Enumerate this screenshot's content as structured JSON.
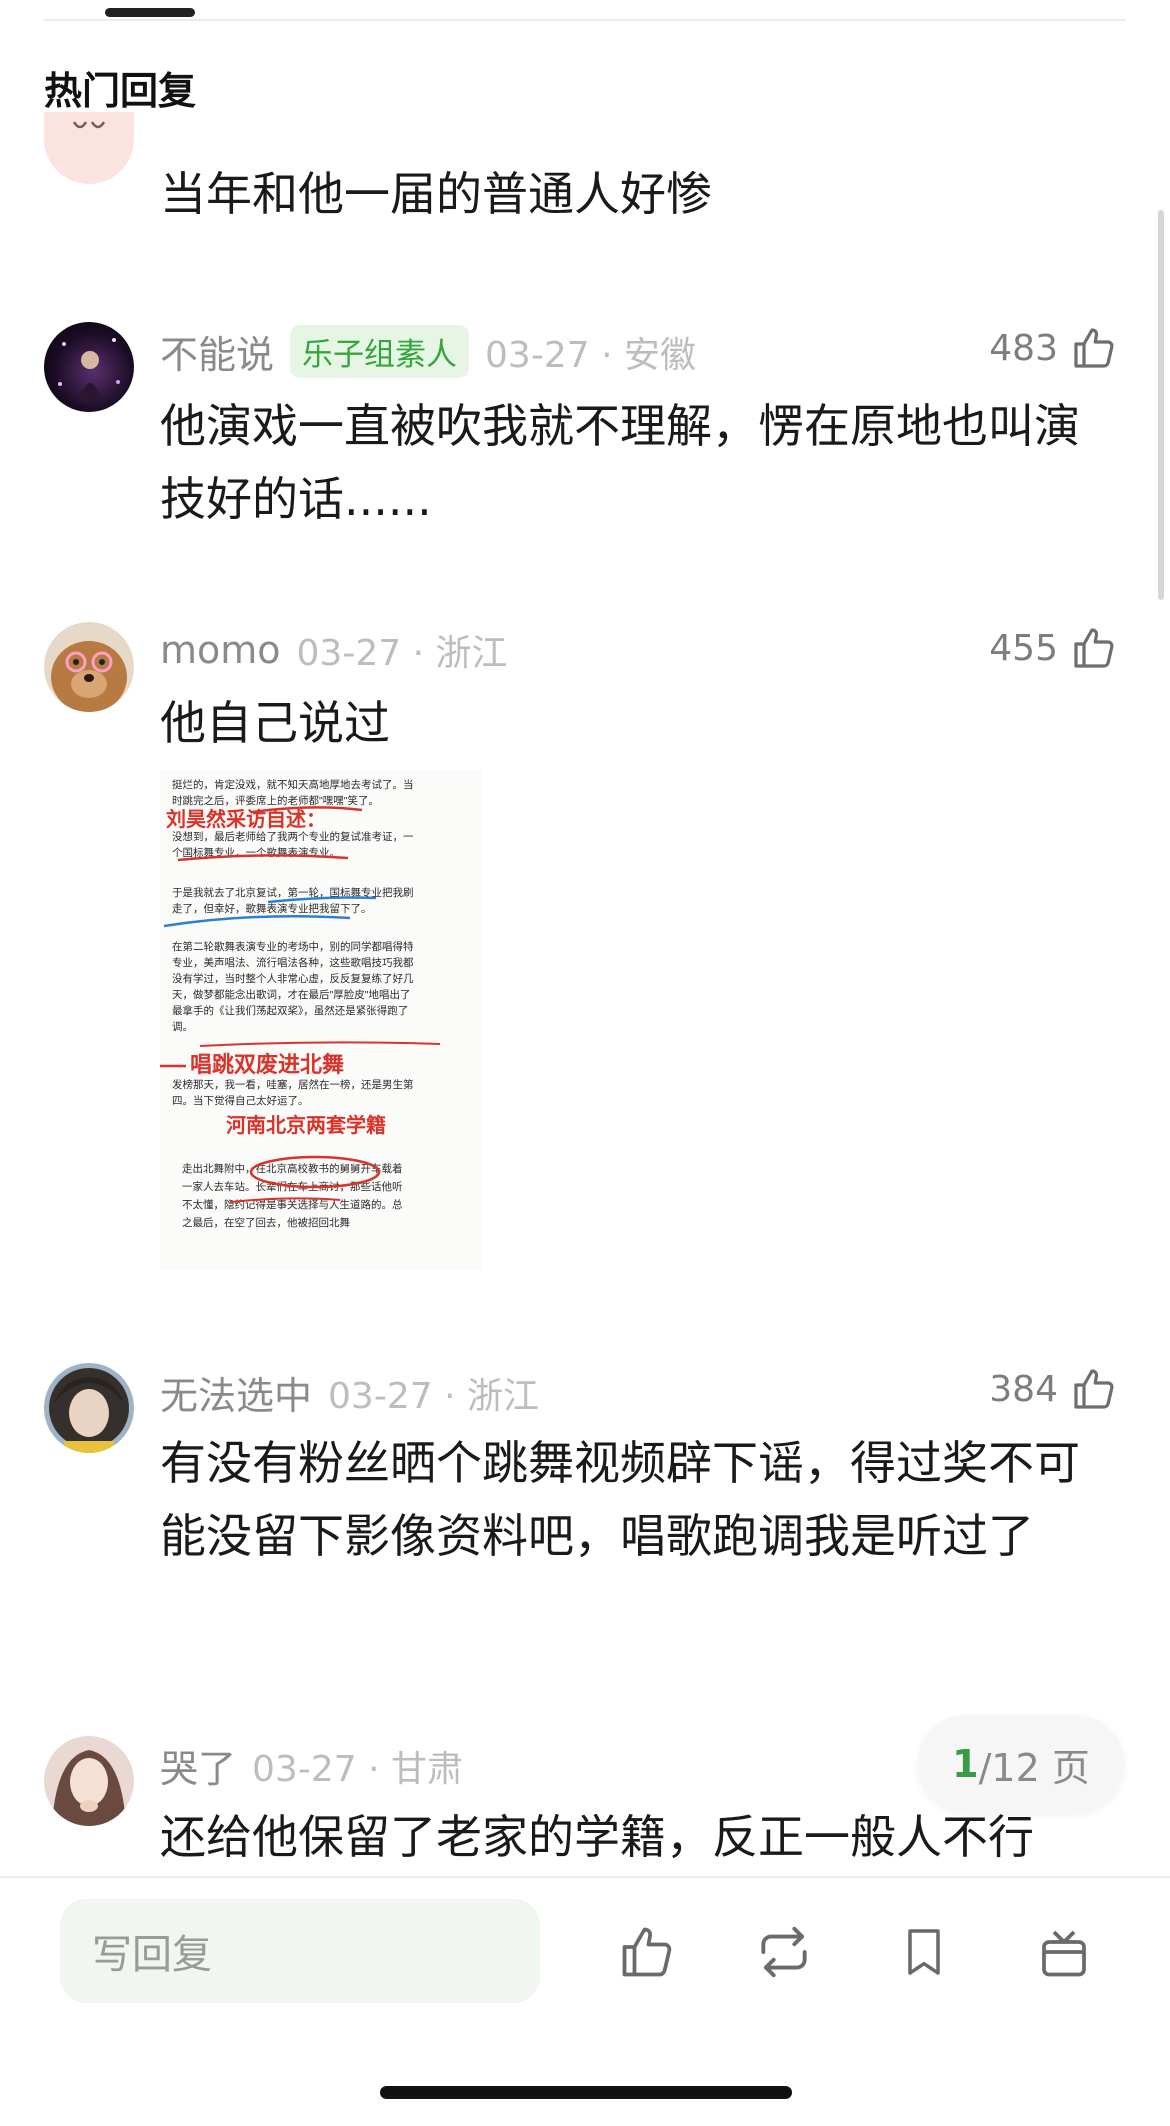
{
  "section_title": "热门回复",
  "comments": [
    {
      "text": "当年和他一届的普通人好惨"
    },
    {
      "name": "不能说",
      "badge": "乐子组素人",
      "meta": "03-27 · 安徽",
      "likes": "483",
      "text": "他演戏一直被吹我就不理解，愣在原地也叫演技好的话......"
    },
    {
      "name": "momo",
      "meta": "03-27 · 浙江",
      "likes": "455",
      "text": "他自己说过"
    },
    {
      "name": "无法选中",
      "meta": "03-27 · 浙江",
      "likes": "384",
      "text": "有没有粉丝晒个跳舞视频辟下谣，得过奖不可能没留下影像资料吧，唱歌跑调我是听过了"
    },
    {
      "name": "哭了",
      "meta": "03-27 · 甘肃",
      "text": "还给他保留了老家的学籍，反正一般人不行"
    }
  ],
  "post_image": {
    "lines": [
      "挺烂的，肯定没戏，就不知天高地厚地去考试了。当",
      "时跳完之后，评委席上的老师都\"嘿嘿\"笑了。",
      "没想到，最后老师给了我两个专业的复试准考证，一",
      "个国标舞专业，一个歌舞表演专业。",
      "于是我就去了北京复试，第一轮，国标舞专业把我刷",
      "走了，但幸好，歌舞表演专业把我留下了。",
      "在第二轮歌舞表演专业的考场中，别的同学都唱得特",
      "专业，美声唱法、流行唱法各种，这些歌唱技巧我都",
      "没有学过，当时整个人非常心虚，反反复复练了好几",
      "天，做梦都能念出歌词，才在最后\"厚脸皮\"地唱出了",
      "最拿手的《让我们荡起双桨》，虽然还是紧张得跑了",
      "调。",
      "发榜那天，我一看，哇塞，居然在一榜，还是男生第",
      "四。当下觉得自己太好运了。",
      "走出北舞附中，在北京高校教书的舅舅开车载着",
      "一家人去车站。长辈们在车上商讨，那些话他听",
      "不太懂，隐约记得是事关选择与人生道路的。总",
      "之最后，在空了回去，他被招回北舞"
    ],
    "annotations": [
      "刘昊然采访自述：",
      "唱跳双废进北舞",
      "河南北京两套学籍"
    ]
  },
  "pager": {
    "current": "1",
    "total": "/12 页"
  },
  "bottom_bar": {
    "reply_placeholder": "写回复"
  },
  "colors": {
    "accent_green": "#3a9b47",
    "badge_bg": "#e7f6e4",
    "annotation_red": "#d9332a",
    "annotation_blue": "#2f7fd1"
  }
}
